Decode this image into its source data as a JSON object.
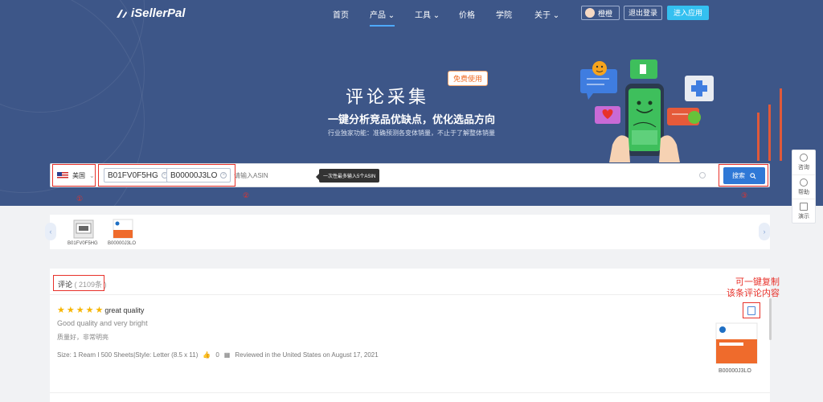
{
  "brand": "iSellerPal",
  "nav": {
    "items": [
      "首页",
      "产品",
      "工具",
      "价格",
      "学院",
      "关于"
    ],
    "user": "橙橙",
    "logout": "退出登录",
    "enter_app": "进入应用"
  },
  "hero": {
    "title": "评论采集",
    "badge": "免费使用",
    "subtitle": "一键分析竞品优缺点，优化选品方向",
    "subtitle2": "行业独家功能：准确预测各变体销量，不止于了解整体销量"
  },
  "search": {
    "region": "美国",
    "tags": [
      "B01FV0F5HG",
      "B00000J3LO"
    ],
    "placeholder": "请输入ASIN",
    "tooltip": "一次性最多输入5个ASIN",
    "button": "搜索",
    "markers": [
      "①",
      "②",
      "③"
    ]
  },
  "sidebar": [
    "咨询",
    "帮助",
    "演示"
  ],
  "products": [
    "B01FV0F5HG",
    "B00000J3LO"
  ],
  "reviews": {
    "label": "评论",
    "count": "( 2109条 )",
    "item": {
      "rating": 5,
      "title": "great quality",
      "text_en": "Good quality and very bright",
      "text_cn": "质量好，非常明亮",
      "meta": "Size: 1 Ream I 500 Sheets|Style: Letter (8.5 x 11)",
      "likes": "0",
      "reviewed": "Reviewed in the United States on August 17, 2021",
      "asin": "B00000J3LO"
    },
    "annotation_line1": "可一键复制",
    "annotation_line2": "该条评论内容"
  },
  "colors": {
    "hero_bg": "#3d5688",
    "accent": "#2f78d6",
    "annotation_red": "#e8312a",
    "star": "#f7b500"
  }
}
